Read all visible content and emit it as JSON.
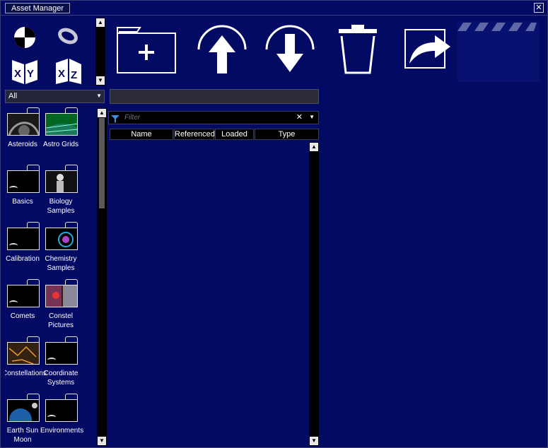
{
  "window": {
    "title": "Asset Manager",
    "close_glyph": "✕"
  },
  "toolbar": {
    "view_icons": [
      "globe-icon",
      "ring-icon",
      "xy-plane-icon",
      "xz-plane-icon"
    ],
    "actions": [
      "new-folder-icon",
      "move-up-icon",
      "move-down-icon",
      "trash-icon",
      "export-icon"
    ]
  },
  "category_dropdown": {
    "value": "All"
  },
  "categories": [
    {
      "label": "Asteroids",
      "thumb": "asteroids"
    },
    {
      "label": "Astro Grids",
      "thumb": "grids"
    },
    {
      "label": "Basics",
      "thumb": "empty"
    },
    {
      "label": "Biology Samples",
      "thumb": "biology"
    },
    {
      "label": "Calibration",
      "thumb": "empty"
    },
    {
      "label": "Chemistry Samples",
      "thumb": "chemistry"
    },
    {
      "label": "Comets",
      "thumb": "empty"
    },
    {
      "label": "Constel Pictures",
      "thumb": "pictures"
    },
    {
      "label": "Constellations",
      "thumb": "constellations"
    },
    {
      "label": "Coordinate Systems",
      "thumb": "empty"
    },
    {
      "label": "Earth Sun Moon",
      "thumb": "earth"
    },
    {
      "label": "Environments",
      "thumb": "empty"
    }
  ],
  "filter": {
    "placeholder": "Filter",
    "clear_glyph": "✕"
  },
  "table": {
    "columns": [
      "Name",
      "Referenced",
      "Loaded",
      "Type"
    ],
    "rows": []
  },
  "colors": {
    "background": "#030a63",
    "panel": "#000000",
    "text": "#ffffff"
  }
}
